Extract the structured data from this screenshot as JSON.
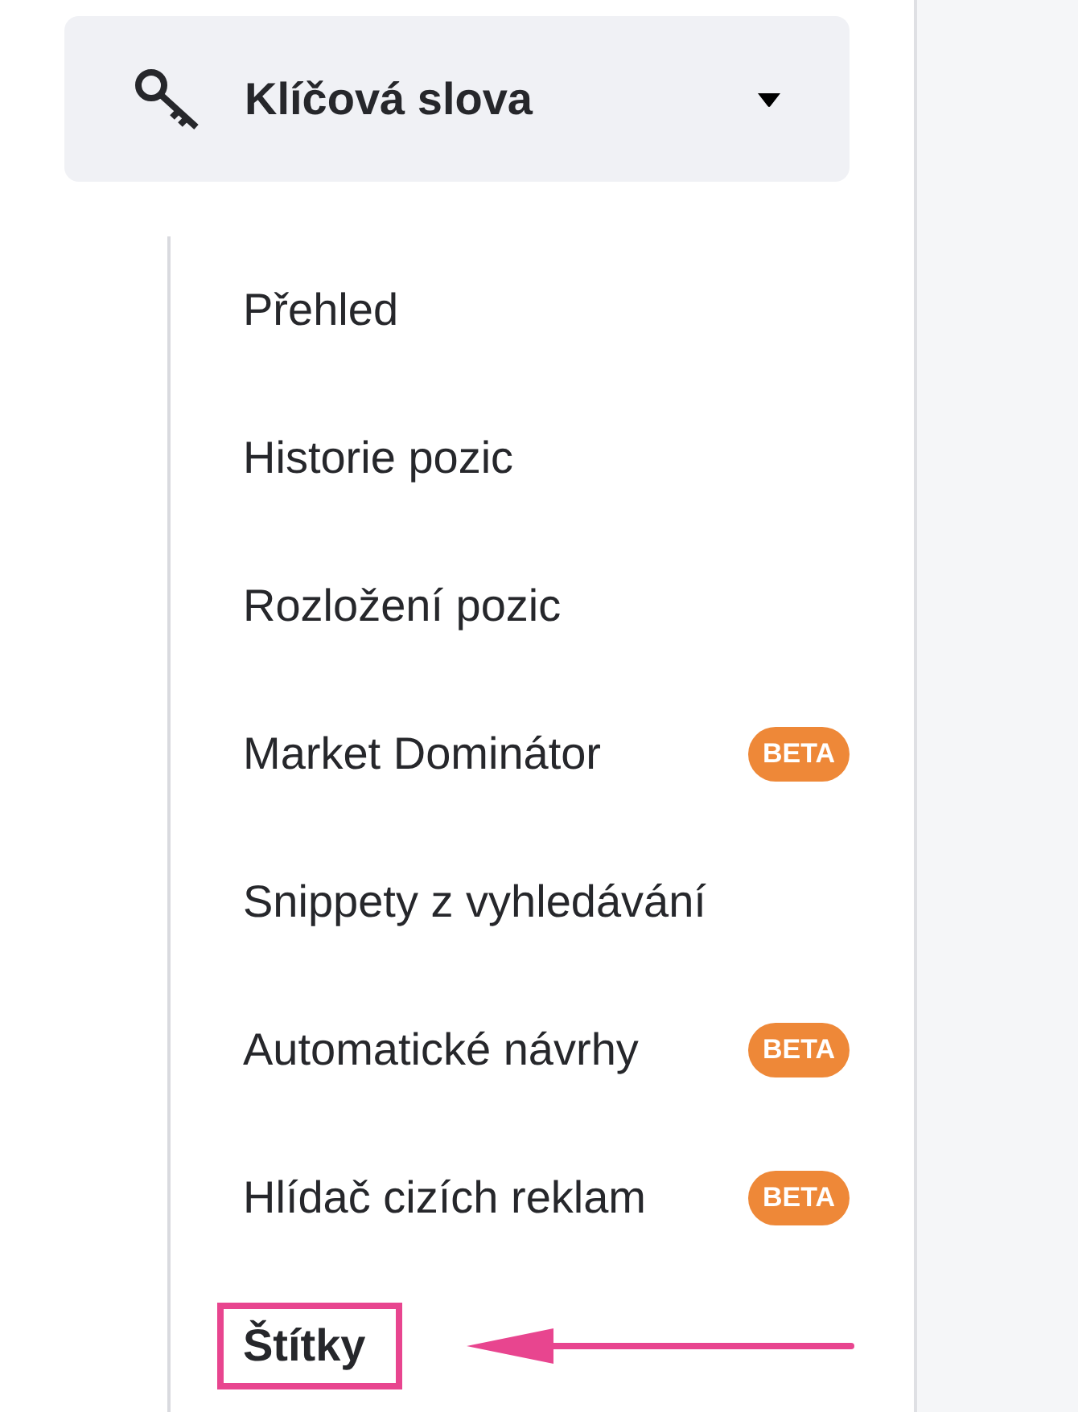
{
  "section": {
    "title": "Klíčová slova",
    "expanded": true
  },
  "items": [
    {
      "label": "Přehled",
      "selected": false,
      "highlighted": false
    },
    {
      "label": "Historie pozic",
      "selected": false,
      "highlighted": false
    },
    {
      "label": "Rozložení pozic",
      "selected": false,
      "highlighted": false
    },
    {
      "label": "Market Dominátor",
      "badge": "BETA",
      "selected": false,
      "highlighted": false
    },
    {
      "label": "Snippety z vyhledávání",
      "selected": false,
      "highlighted": false
    },
    {
      "label": "Automatické návrhy",
      "badge": "BETA",
      "selected": false,
      "highlighted": false
    },
    {
      "label": "Hlídač cizích reklam",
      "badge": "BETA",
      "selected": false,
      "highlighted": false
    },
    {
      "label": "Štítky",
      "selected": true,
      "highlighted": true
    }
  ]
}
